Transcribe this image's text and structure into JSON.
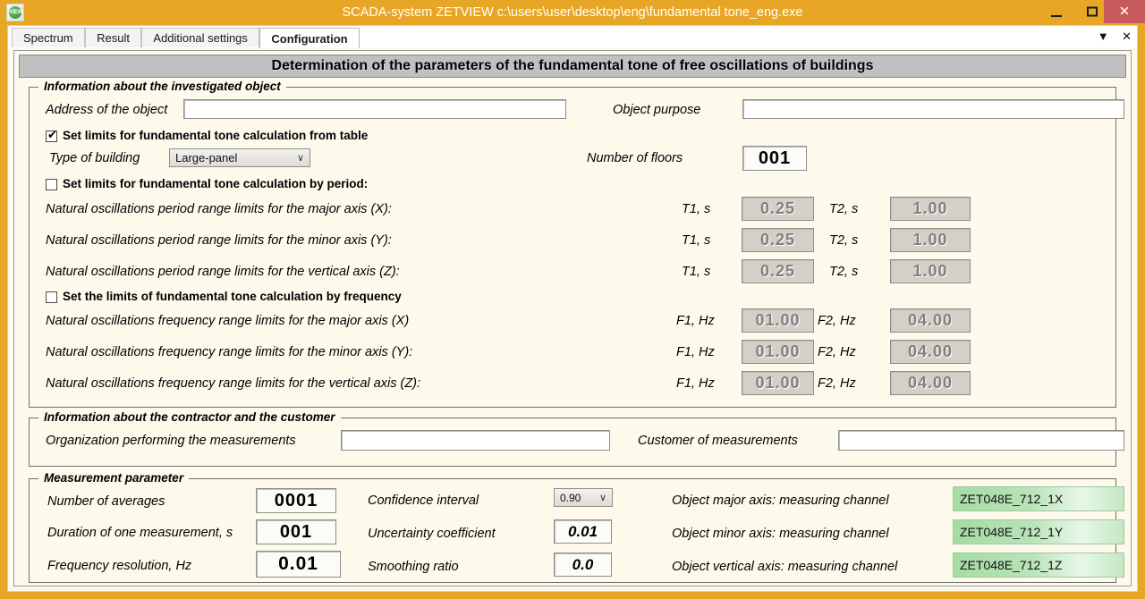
{
  "window": {
    "title": "SCADA-system ZETVIEW c:\\users\\user\\desktop\\eng\\fundamental tone_eng.exe",
    "icon_text": "VIEW",
    "minimize_label": "",
    "maximize_label": "",
    "close_label": "✕",
    "accent_color": "#e8a626",
    "close_color": "#c75b5b"
  },
  "tabs": {
    "items": [
      {
        "label": "Spectrum",
        "active": false
      },
      {
        "label": "Result",
        "active": false
      },
      {
        "label": "Additional settings",
        "active": false
      },
      {
        "label": "Configuration",
        "active": true
      }
    ],
    "dropdown_icon": "▼",
    "close_icon": "✕"
  },
  "page": {
    "title": "Determination of the parameters of the fundamental tone of free oscillations of buildings"
  },
  "object_group": {
    "title": "Information about the investigated object",
    "address_label": "Address of the object",
    "address_value": "",
    "object_purpose_label": "Object purpose",
    "object_purpose_value": "",
    "table_checkbox": {
      "label": "Set limits for fundamental tone calculation from table",
      "checked": true,
      "tick": "✔"
    },
    "type_of_building_label": "Type of building",
    "type_of_building_value": "Large-panel",
    "type_of_building_arrow": "∨",
    "number_of_floors_label": "Number of floors",
    "number_of_floors_value": "001",
    "period_checkbox": {
      "label": "Set limits for fundamental tone calculation by period:",
      "checked": false
    },
    "period_rows": [
      {
        "label": "Natural oscillations period range limits for the major axis (X):",
        "t1_label": "T1, s",
        "t1_value": "0.25",
        "t2_label": "T2, s",
        "t2_value": "1.00"
      },
      {
        "label": "Natural oscillations period range limits for the minor axis (Y):",
        "t1_label": "T1, s",
        "t1_value": "0.25",
        "t2_label": "T2, s",
        "t2_value": "1.00"
      },
      {
        "label": "Natural oscillations period range limits for the vertical axis (Z):",
        "t1_label": "T1, s",
        "t1_value": "0.25",
        "t2_label": "T2, s",
        "t2_value": "1.00"
      }
    ],
    "frequency_checkbox": {
      "label": "Set the limits of fundamental tone calculation by frequency",
      "checked": false
    },
    "frequency_rows": [
      {
        "label": "Natural oscillations frequency range limits for the major axis (X)",
        "f1_label": "F1, Hz",
        "f1_value": "01.00",
        "f2_label": "F2, Hz",
        "f2_value": "04.00"
      },
      {
        "label": "Natural oscillations frequency range limits for the minor axis (Y):",
        "f1_label": "F1, Hz",
        "f1_value": "01.00",
        "f2_label": "F2, Hz",
        "f2_value": "04.00"
      },
      {
        "label": "Natural oscillations frequency range limits for the vertical axis (Z):",
        "f1_label": "F1, Hz",
        "f1_value": "01.00",
        "f2_label": "F2, Hz",
        "f2_value": "04.00"
      }
    ]
  },
  "contractor_group": {
    "title": "Information about the contractor and the customer",
    "organization_label": "Organization performing the measurements",
    "organization_value": "",
    "customer_label": "Customer of measurements",
    "customer_value": ""
  },
  "measurement_group": {
    "title": "Measurement parameter",
    "number_of_averages_label": "Number of averages",
    "number_of_averages_value": "0001",
    "duration_label": "Duration of one measurement, s",
    "duration_value": "001",
    "frequency_resolution_label": "Frequency resolution, Hz",
    "frequency_resolution_value": "0.01",
    "confidence_interval_label": "Confidence interval",
    "confidence_interval_value": "0.90",
    "confidence_interval_arrow": "∨",
    "uncertainty_label": "Uncertainty coefficient",
    "uncertainty_value": "0.01",
    "smoothing_label": "Smoothing ratio",
    "smoothing_value": "0.0",
    "channels": [
      {
        "label": "Object major axis: measuring channel",
        "value": "ZET048E_712_1X"
      },
      {
        "label": "Object minor axis: measuring channel",
        "value": "ZET048E_712_1Y"
      },
      {
        "label": "Object vertical axis: measuring channel",
        "value": "ZET048E_712_1Z"
      }
    ],
    "channel_color": "#a5dca5"
  }
}
